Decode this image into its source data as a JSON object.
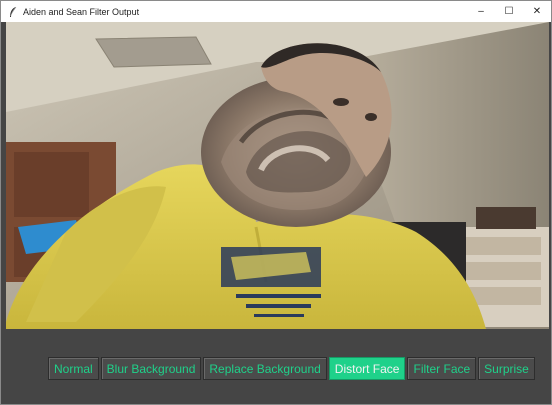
{
  "window": {
    "title": "Aiden and Sean Filter Output",
    "controls": {
      "minimize": "–",
      "maximize": "☐",
      "close": "✕"
    }
  },
  "video": {
    "icon": "webcam-feed",
    "active_effect": "Distort Face"
  },
  "toolbar": {
    "buttons": [
      {
        "label": "Normal",
        "active": false
      },
      {
        "label": "Blur Background",
        "active": false
      },
      {
        "label": "Replace Background",
        "active": false
      },
      {
        "label": "Distort Face",
        "active": true
      },
      {
        "label": "Filter Face",
        "active": false
      },
      {
        "label": "Surprise",
        "active": false
      }
    ]
  },
  "colors": {
    "accent": "#1fd18a",
    "button_bg": "#4b4b4b",
    "panel_bg": "#454545",
    "hoodie": "#d9c84a"
  }
}
